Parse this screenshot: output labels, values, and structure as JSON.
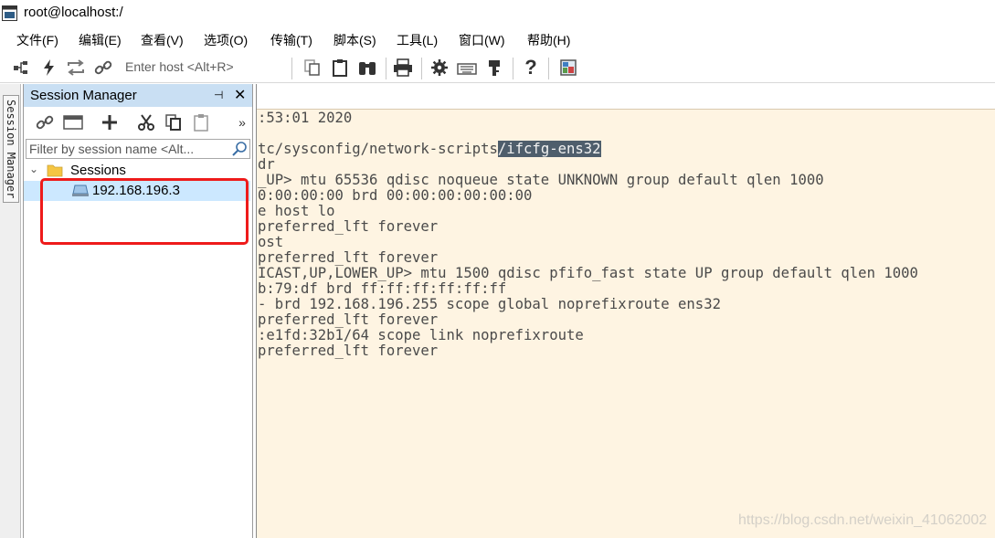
{
  "window": {
    "title": "root@localhost:/"
  },
  "menu": [
    "文件(F)",
    "编辑(E)",
    "查看(V)",
    "选项(O)",
    "传输(T)",
    "脚本(S)",
    "工具(L)",
    "窗口(W)",
    "帮助(H)"
  ],
  "toolbar": {
    "host_placeholder": "Enter host <Alt+R>",
    "icons": [
      "connect-tree-icon",
      "lightning-icon",
      "reconnect-icon",
      "link-icon",
      "copy-icon",
      "paste-icon",
      "find-icon",
      "print-icon",
      "settings-icon",
      "keymap-icon",
      "key-icon",
      "help-icon",
      "screen-icon"
    ]
  },
  "side_tab": {
    "label": "Session Manager"
  },
  "session_manager": {
    "title": "Session Manager",
    "pin_glyph": "⊣",
    "close_glyph": "✕",
    "filter_placeholder": "Filter by session name <Alt...",
    "tree": {
      "root": {
        "label": "Sessions"
      },
      "items": [
        {
          "label": "192.168.196.3"
        }
      ]
    },
    "annotation_color": "#ee1b1b"
  },
  "terminal": {
    "lines": [
      {
        "text": ":53:01 2020"
      },
      {
        "text": ""
      },
      {
        "text": "tc/sysconfig/network-scripts",
        "highlight": "/ifcfg-ens32"
      },
      {
        "text": "dr"
      },
      {
        "text": "_UP> mtu 65536 qdisc noqueue state UNKNOWN group default qlen 1000"
      },
      {
        "text": "0:00:00:00 brd 00:00:00:00:00:00"
      },
      {
        "text": "e host lo"
      },
      {
        "text": "preferred_lft forever"
      },
      {
        "text": "ost"
      },
      {
        "text": "preferred_lft forever"
      },
      {
        "text": "ICAST,UP,LOWER_UP> mtu 1500 qdisc pfifo_fast state UP group default qlen 1000"
      },
      {
        "text": "b:79:df brd ff:ff:ff:ff:ff:ff"
      },
      {
        "text": "- brd 192.168.196.255 scope global noprefixroute ens32"
      },
      {
        "text": "preferred_lft forever"
      },
      {
        "text": ":e1fd:32b1/64 scope link noprefixroute"
      },
      {
        "text": "preferred_lft forever"
      }
    ],
    "background": "#fef4e2",
    "highlight_bg": "#4f5e6c"
  },
  "watermark": "https://blog.csdn.net/weixin_41062002"
}
